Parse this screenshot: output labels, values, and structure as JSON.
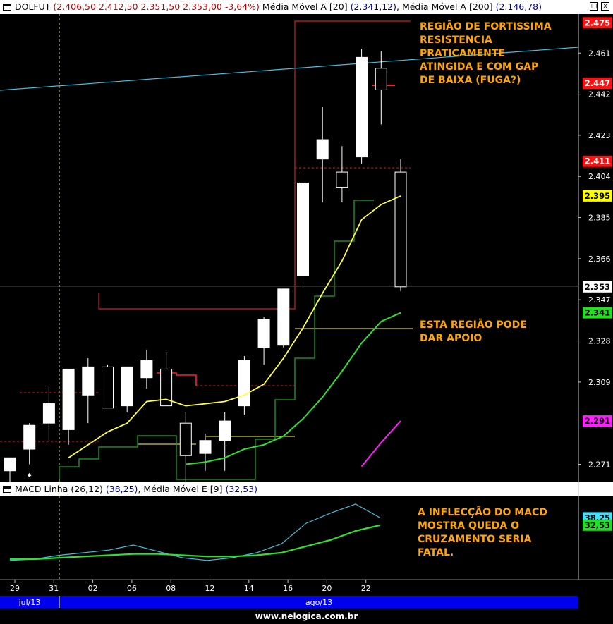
{
  "main_header": {
    "symbol": "DOLFUT",
    "ohlc": "(2.406,50  2.412,50  2.351,50  2.353,00  -3,64%)",
    "ma1_label": "Média Móvel A [20]",
    "ma1_value": "(2.341,12)",
    "ma2_label": "Média Móvel A [200]",
    "ma2_value": "(2.146,78)",
    "maximize": "□",
    "close": "x"
  },
  "macd_header": {
    "label": "MACD Linha (26,12)",
    "value": "(38,25)",
    "signal_label": "Média Móvel E [9]",
    "signal_value": "(32,53)"
  },
  "annotations": {
    "resistance": [
      "REGIÃO DE FORTISSIMA",
      "RESISTENCIA",
      "PRATICAMENTE",
      "ATINGIDA E COM GAP",
      "DE BAIXA (FUGA?)"
    ],
    "support": [
      "ESTA REGIÃO PODE",
      "DAR APOIO"
    ],
    "macd": [
      "A INFLECÇÃO DO MACD",
      "MOSTRA QUEDA O",
      "CRUZAMENTO SERIA",
      "FATAL."
    ]
  },
  "months": [
    "jul/13",
    "ago/13"
  ],
  "footer": "www.nelogica.com.br",
  "colors": {
    "background": "#000000",
    "candle_up": "#ffffff",
    "ma20": "#ffff40",
    "ma200": "#30e030",
    "stop_line": "#1a8c1a",
    "trend_line": "#40c0e0",
    "macd_line": "#40c0e0",
    "macd_signal": "#30e030",
    "magenta": "#ff20ff",
    "resistance_box": "#d02020",
    "annotation": "#ffa500",
    "month_bar": "#0000ee"
  },
  "chart_data": [
    {
      "type": "candlestick",
      "title": "DOLFUT",
      "ylim": [
        2.264,
        2.479
      ],
      "y_ticks": [
        "2.461",
        "2.442",
        "2.423",
        "2.404",
        "2.385",
        "2.366",
        "2.347",
        "2.328",
        "2.309",
        "2.271"
      ],
      "x_ticks": [
        "29",
        "31",
        "02",
        "06",
        "08",
        "12",
        "14",
        "16",
        "20",
        "22"
      ],
      "price_tags": [
        {
          "label": "2.475",
          "value": 2.475,
          "bg": "#ff1010",
          "fg": "#ffffff"
        },
        {
          "label": "2.447",
          "value": 2.447,
          "bg": "#ff1010",
          "fg": "#ffffff"
        },
        {
          "label": "2.411",
          "value": 2.411,
          "bg": "#ff1010",
          "fg": "#ffffff"
        },
        {
          "label": "2.395",
          "value": 2.395,
          "bg": "#ffff00",
          "fg": "#000000"
        },
        {
          "label": "2.353",
          "value": 2.353,
          "bg": "#ffffff",
          "fg": "#000000"
        },
        {
          "label": "2.341",
          "value": 2.341,
          "bg": "#20e020",
          "fg": "#000000"
        },
        {
          "label": "2.291",
          "value": 2.291,
          "bg": "#ff20ff",
          "fg": "#000000"
        }
      ],
      "candles": [
        {
          "o": 2.268,
          "h": 2.274,
          "l": 2.262,
          "c": 2.274
        },
        {
          "o": 2.278,
          "h": 2.29,
          "l": 2.271,
          "c": 2.289
        },
        {
          "o": 2.29,
          "h": 2.307,
          "l": 2.282,
          "c": 2.299
        },
        {
          "o": 2.287,
          "h": 2.315,
          "l": 2.28,
          "c": 2.315
        },
        {
          "o": 2.303,
          "h": 2.32,
          "l": 2.29,
          "c": 2.316
        },
        {
          "o": 2.316,
          "h": 2.317,
          "l": 2.297,
          "c": 2.297
        },
        {
          "o": 2.298,
          "h": 2.316,
          "l": 2.295,
          "c": 2.316
        },
        {
          "o": 2.311,
          "h": 2.324,
          "l": 2.306,
          "c": 2.319
        },
        {
          "o": 2.315,
          "h": 2.323,
          "l": 2.298,
          "c": 2.298
        },
        {
          "o": 2.29,
          "h": 2.295,
          "l": 2.262,
          "c": 2.275
        },
        {
          "o": 2.276,
          "h": 2.285,
          "l": 2.268,
          "c": 2.282
        },
        {
          "o": 2.282,
          "h": 2.295,
          "l": 2.268,
          "c": 2.291
        },
        {
          "o": 2.298,
          "h": 2.321,
          "l": 2.294,
          "c": 2.319
        },
        {
          "o": 2.325,
          "h": 2.339,
          "l": 2.317,
          "c": 2.338
        },
        {
          "o": 2.326,
          "h": 2.352,
          "l": 2.325,
          "c": 2.352
        },
        {
          "o": 2.358,
          "h": 2.406,
          "l": 2.354,
          "c": 2.401
        },
        {
          "o": 2.412,
          "h": 2.436,
          "l": 2.392,
          "c": 2.421
        },
        {
          "o": 2.406,
          "h": 2.418,
          "l": 2.392,
          "c": 2.399
        },
        {
          "o": 2.413,
          "h": 2.463,
          "l": 2.41,
          "c": 2.459
        },
        {
          "o": 2.454,
          "h": 2.462,
          "l": 2.428,
          "c": 2.444
        },
        {
          "o": 2.406,
          "h": 2.412,
          "l": 2.351,
          "c": 2.353
        }
      ],
      "series": [
        {
          "kind": "ma20",
          "values": [
            null,
            null,
            null,
            2.274,
            2.28,
            2.286,
            2.29,
            2.3,
            2.301,
            2.298,
            2.299,
            2.3,
            2.303,
            2.308,
            2.32,
            2.334,
            2.35,
            2.365,
            2.384,
            2.391,
            2.395
          ]
        },
        {
          "kind": "ma200",
          "values": [
            null,
            null,
            null,
            null,
            null,
            null,
            2.271,
            2.272,
            2.274,
            2.278,
            2.28,
            2.284,
            2.292,
            2.302,
            2.314,
            2.327,
            2.337,
            2.341
          ]
        },
        {
          "kind": "magenta",
          "values": [
            2.27,
            2.281,
            2.291
          ]
        }
      ]
    },
    {
      "type": "line",
      "title": "MACD Linha (26,12)",
      "ylim": [
        -10,
        55
      ],
      "series": [
        {
          "name": "MACD Linha (26,12)",
          "values": [
            5,
            6,
            9,
            11,
            13,
            17,
            12,
            7,
            5,
            7,
            11,
            18,
            34,
            42,
            49,
            38.25
          ]
        },
        {
          "name": "Média Móvel E [9]",
          "values": [
            6,
            6,
            7,
            8,
            9,
            10,
            10,
            9,
            8,
            8,
            9,
            11,
            16,
            21,
            28,
            32.53
          ]
        }
      ],
      "value_tags": [
        {
          "label": "38,25",
          "value": 38.25,
          "bg": "#40e0ff"
        },
        {
          "label": "32,53",
          "value": 32.53,
          "bg": "#20e020"
        }
      ]
    }
  ]
}
